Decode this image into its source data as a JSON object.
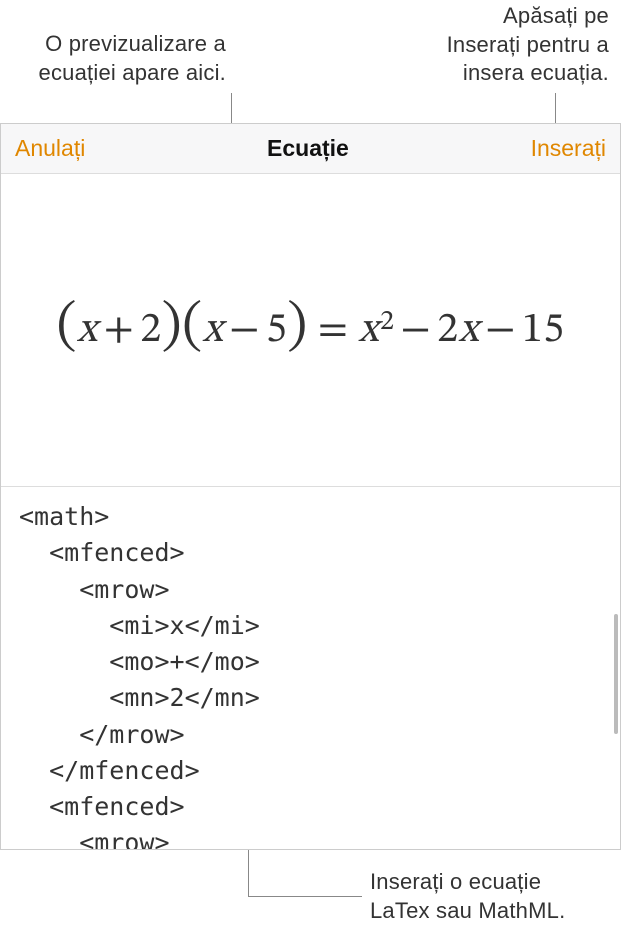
{
  "callouts": {
    "preview": "O previzualizare a\necuației apare aici.",
    "insert": "Apăsați pe\nInserați pentru a\ninsera ecuația.",
    "latexInput": "Inserați o ecuație\nLaTex sau MathML."
  },
  "toolbar": {
    "cancel_label": "Anulați",
    "title": "Ecuație",
    "insert_label": "Inserați"
  },
  "equation": {
    "display": "(x + 2)(x − 5) = x² − 2x − 15",
    "parts": {
      "x": "x",
      "plus": "+",
      "two": "2",
      "minus": "−",
      "five": "5",
      "eq": "=",
      "sq": "2",
      "coef2": "2",
      "fifteen": "15"
    }
  },
  "code_area": {
    "content": "<math>\n  <mfenced>\n    <mrow>\n      <mi>x</mi>\n      <mo>+</mo>\n      <mn>2</mn>\n    </mrow>\n  </mfenced>\n  <mfenced>\n    <mrow>"
  }
}
